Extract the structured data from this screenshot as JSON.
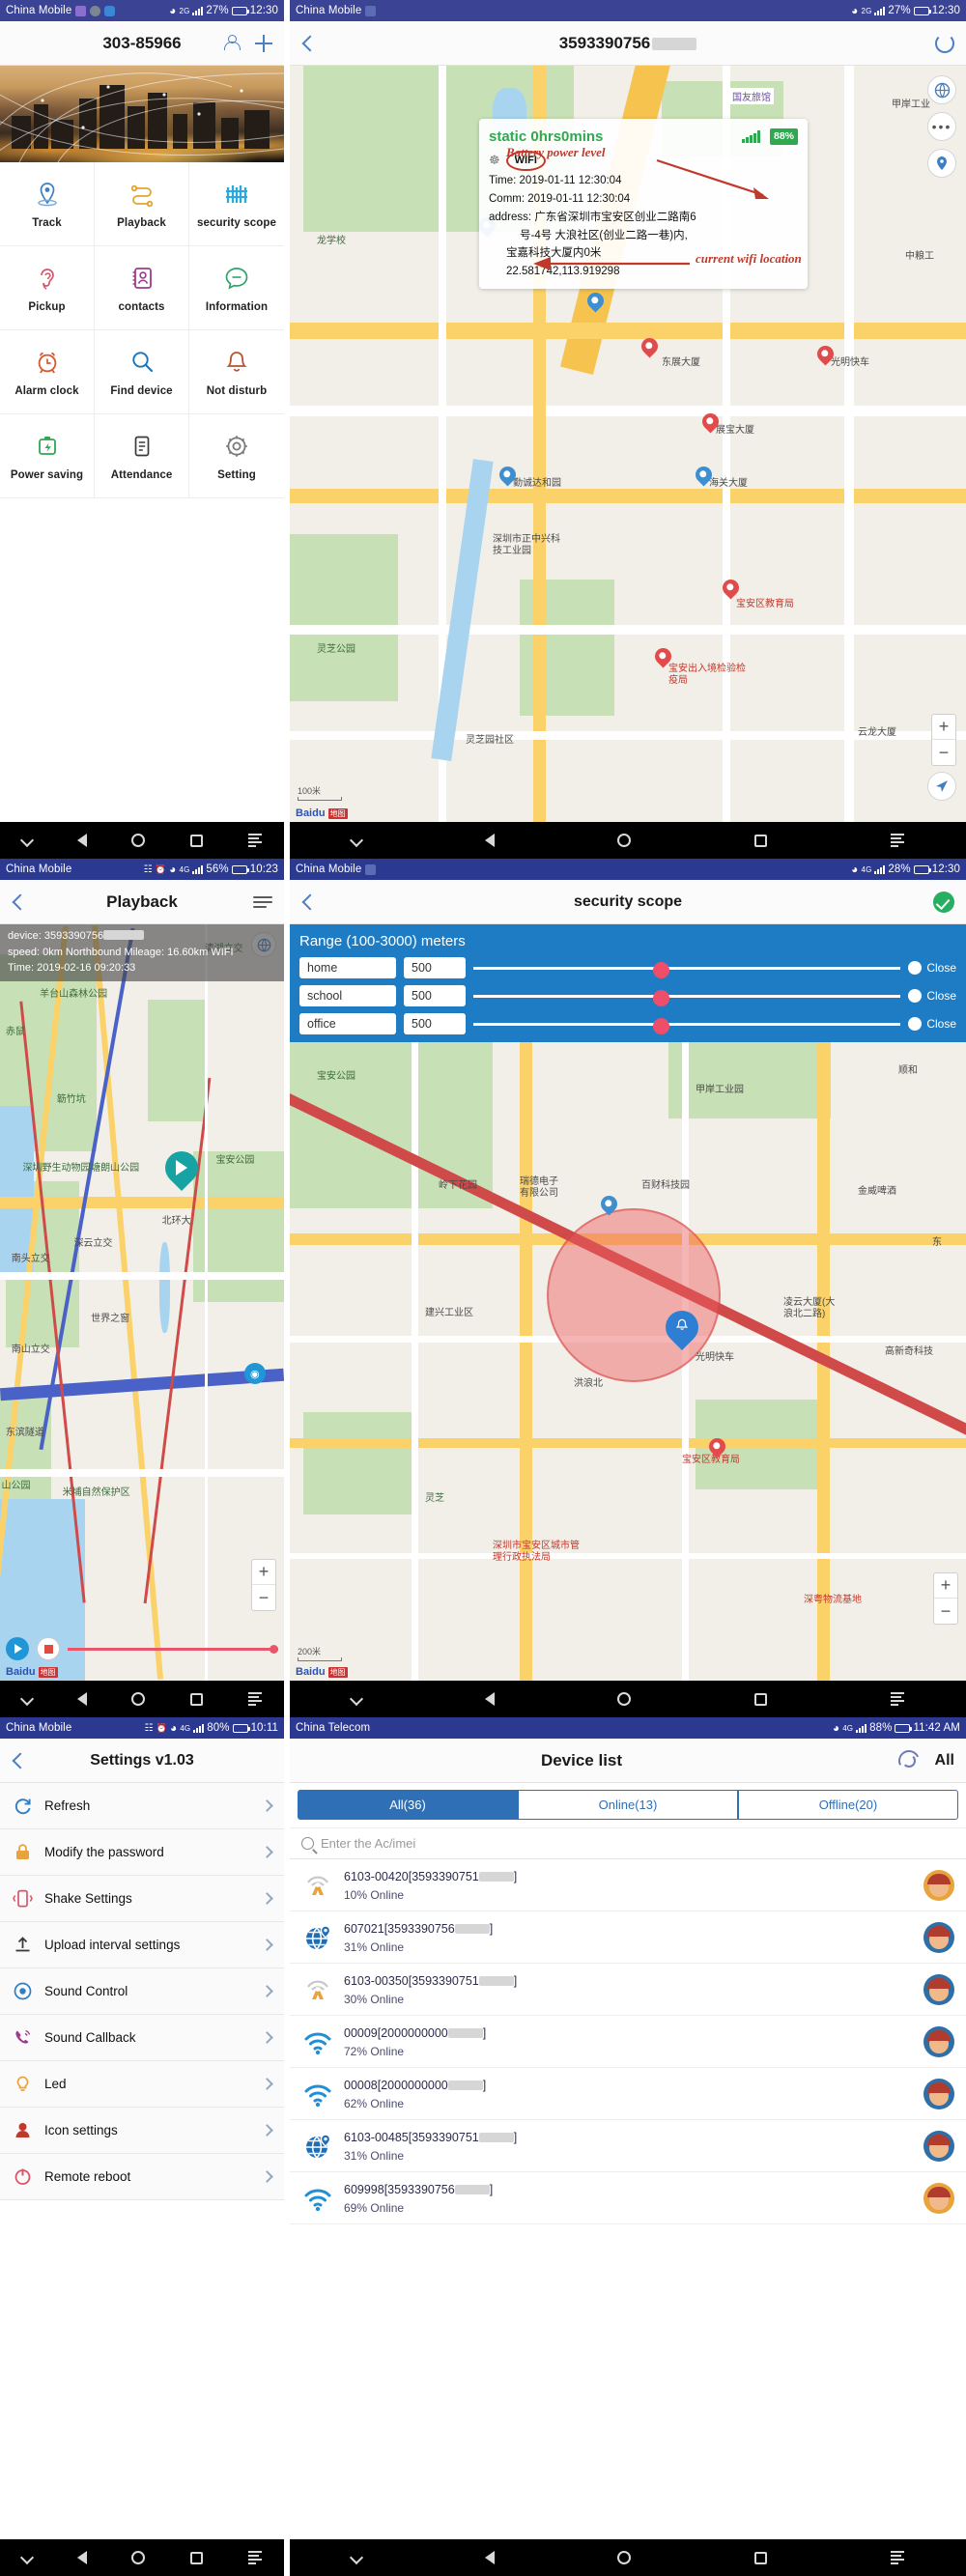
{
  "panels": {
    "home": {
      "status": {
        "carrier": "China Mobile",
        "net": "2G",
        "battery": "27%",
        "time": "12:30"
      },
      "nav": {
        "title": "303-85966",
        "person_icon": "person-icon",
        "plus_icon": "plus-icon"
      },
      "grid": [
        {
          "label": "Track",
          "icon": "map-pin-icon",
          "color": "#3e7fc1"
        },
        {
          "label": "Playback",
          "icon": "route-icon",
          "color": "#e3a52c"
        },
        {
          "label": "security scope",
          "icon": "fence-icon",
          "color": "#2aa9e0"
        },
        {
          "label": "Pickup",
          "icon": "ear-icon",
          "color": "#d9566a"
        },
        {
          "label": "contacts",
          "icon": "contact-book-icon",
          "color": "#9c3b8f"
        },
        {
          "label": "Information",
          "icon": "chat-bubble-icon",
          "color": "#2fa36b"
        },
        {
          "label": "Alarm clock",
          "icon": "alarm-clock-icon",
          "color": "#d9582c"
        },
        {
          "label": "Find device",
          "icon": "magnifier-icon",
          "color": "#1b74b8"
        },
        {
          "label": "Not disturb",
          "icon": "bell-off-icon",
          "color": "#b8522f"
        },
        {
          "label": "Power saving",
          "icon": "battery-bolt-icon",
          "color": "#2fa84f"
        },
        {
          "label": "Attendance",
          "icon": "clipboard-icon",
          "color": "#3a3a3a"
        },
        {
          "label": "Setting",
          "icon": "gear-icon",
          "color": "#7a7a7a"
        }
      ]
    },
    "track": {
      "status": {
        "carrier": "China Mobile",
        "net": "2G",
        "battery": "27%",
        "time": "12:30"
      },
      "nav": {
        "title": "3593390756",
        "refresh_icon": "refresh-icon"
      },
      "popup": {
        "static_label": "static 0hrs0mins",
        "battery": "88%",
        "wifi_badge": "WIFI",
        "time_label": "Time:",
        "time_value": "2019-01-11 12:30:04",
        "comm_label": "Comm:",
        "comm_value": "2019-01-11 12:30:04",
        "address_label": "address:",
        "address_line1": "广东省深圳市宝安区创业二路南6",
        "address_line2": "号-4号 大浪社区(创业二路一巷)内,",
        "address_line3": "宝嘉科技大厦内0米",
        "coords": "22.581742,113.919298"
      },
      "annotations": [
        {
          "text": "Battery power level"
        },
        {
          "text": "current wifi location"
        }
      ],
      "map_labels": [
        "国友旅馆",
        "甲岸工业",
        "龙学校",
        "东展大厦",
        "光明快车",
        "展宝大厦",
        "勤诚达和园",
        "海关大厦",
        "深圳市正中兴科技工业园",
        "宝安区教育局",
        "宝安出入境检验检疫局",
        "云龙大厦",
        "灵芝公园",
        "灵芝园社区",
        "中粮工"
      ],
      "scale": "100米",
      "attribution": "Baidu"
    },
    "playback": {
      "status": {
        "carrier": "China Mobile",
        "net": "4G",
        "battery": "56%",
        "time": "10:23"
      },
      "nav": {
        "title": "Playback",
        "menu_icon": "hamburger-icon"
      },
      "info": {
        "device_label": "device:",
        "device_value": "3593390756",
        "speed_label": "speed:",
        "speed_value": "0km Northbound  Mileage: 16.60km WIFI",
        "time_label": "Time:",
        "time_value": "2019-02-16 09:20:33"
      },
      "map_labels": [
        "赤鼠",
        "羊台山森林公园",
        "簕竹坑",
        "深圳野生动物园",
        "塘朗山公园",
        "南头立交",
        "深云立交",
        "北环大",
        "世界之窗",
        "南山立交",
        "东滨隧道",
        "山公园",
        "米埔自然保护区",
        "清湖立交",
        "宝安公园"
      ],
      "attribution": "Baidu"
    },
    "scope": {
      "status": {
        "carrier": "China Mobile",
        "net": "4G",
        "battery": "28%",
        "time": "12:30"
      },
      "nav": {
        "title": "security scope",
        "confirm_icon": "check-icon"
      },
      "range_title": "Range (100-3000) meters",
      "rows": [
        {
          "name": "home",
          "value": "500",
          "state": "Close"
        },
        {
          "name": "school",
          "value": "500",
          "state": "Close"
        },
        {
          "name": "office",
          "value": "500",
          "state": "Close"
        }
      ],
      "map_labels": [
        "宝安公园",
        "甲岸工业园",
        "顺和",
        "岭下花园",
        "瑞德电子有限公司",
        "百财科技园",
        "金威啤酒",
        "建兴工业区",
        "洪浪北",
        "光明快车",
        "凌云大厦(大浪北二路)",
        "高新奇科技",
        "宝安区教育局",
        "灵芝",
        "深圳市宝安区城市管理行政执法局",
        "深粤物流基地",
        "东"
      ],
      "scale": "200米",
      "attribution": "Baidu"
    },
    "settings": {
      "status": {
        "carrier": "China Mobile",
        "net": "4G",
        "battery": "80%",
        "time": "10:11"
      },
      "nav": {
        "title": "Settings v1.03"
      },
      "items": [
        {
          "label": "Refresh",
          "icon": "refresh-icon",
          "color": "#2f7fc4"
        },
        {
          "label": "Modify the password",
          "icon": "lock-icon",
          "color": "#e8a33d"
        },
        {
          "label": "Shake Settings",
          "icon": "phone-shake-icon",
          "color": "#d9566a"
        },
        {
          "label": "Upload interval settings",
          "icon": "upload-icon",
          "color": "#3a3a3a"
        },
        {
          "label": "Sound Control",
          "icon": "sound-control-icon",
          "color": "#2f7fc4"
        },
        {
          "label": "Sound Callback",
          "icon": "phone-call-icon",
          "color": "#9c3b8f"
        },
        {
          "label": "Led",
          "icon": "bulb-icon",
          "color": "#e8a33d"
        },
        {
          "label": "Icon settings",
          "icon": "icon-settings-icon",
          "color": "#c0392b"
        },
        {
          "label": "Remote reboot",
          "icon": "power-icon",
          "color": "#d9566a"
        }
      ]
    },
    "devicelist": {
      "status": {
        "carrier": "China Telecom",
        "net": "4G",
        "battery": "88%",
        "time": "11:42 AM"
      },
      "nav": {
        "title": "Device list",
        "sync_icon": "sync-icon",
        "all_label": "All"
      },
      "tabs": [
        {
          "label": "All(36)",
          "active": true
        },
        {
          "label": "Online(13)",
          "active": false
        },
        {
          "label": "Offline(20)",
          "active": false
        }
      ],
      "search_placeholder": "Enter the Ac/imei",
      "devices": [
        {
          "name": "6103-00420[3593390751",
          "status": "10%  Online",
          "icon": "tower-icon",
          "avatar": "orange"
        },
        {
          "name": "607021[3593390756",
          "status": "31%  Online",
          "icon": "globe-pin-icon",
          "avatar": "blue"
        },
        {
          "name": "6103-00350[3593390751",
          "status": "30%  Online",
          "icon": "tower-icon",
          "avatar": "blue"
        },
        {
          "name": "00009[2000000000",
          "status": "72%  Online",
          "icon": "wifi-icon",
          "avatar": "blue"
        },
        {
          "name": "00008[2000000000",
          "status": "62%  Online",
          "icon": "wifi-icon",
          "avatar": "blue"
        },
        {
          "name": "6103-00485[3593390751",
          "status": "31%  Online",
          "icon": "globe-pin-icon",
          "avatar": "blue"
        },
        {
          "name": "609998[3593390756",
          "status": "69%  Online",
          "icon": "wifi-icon",
          "avatar": "orange"
        }
      ]
    }
  },
  "android": {
    "back": "back-icon",
    "home": "home-icon",
    "recent": "recent-icon",
    "menu": "menu-icon"
  }
}
